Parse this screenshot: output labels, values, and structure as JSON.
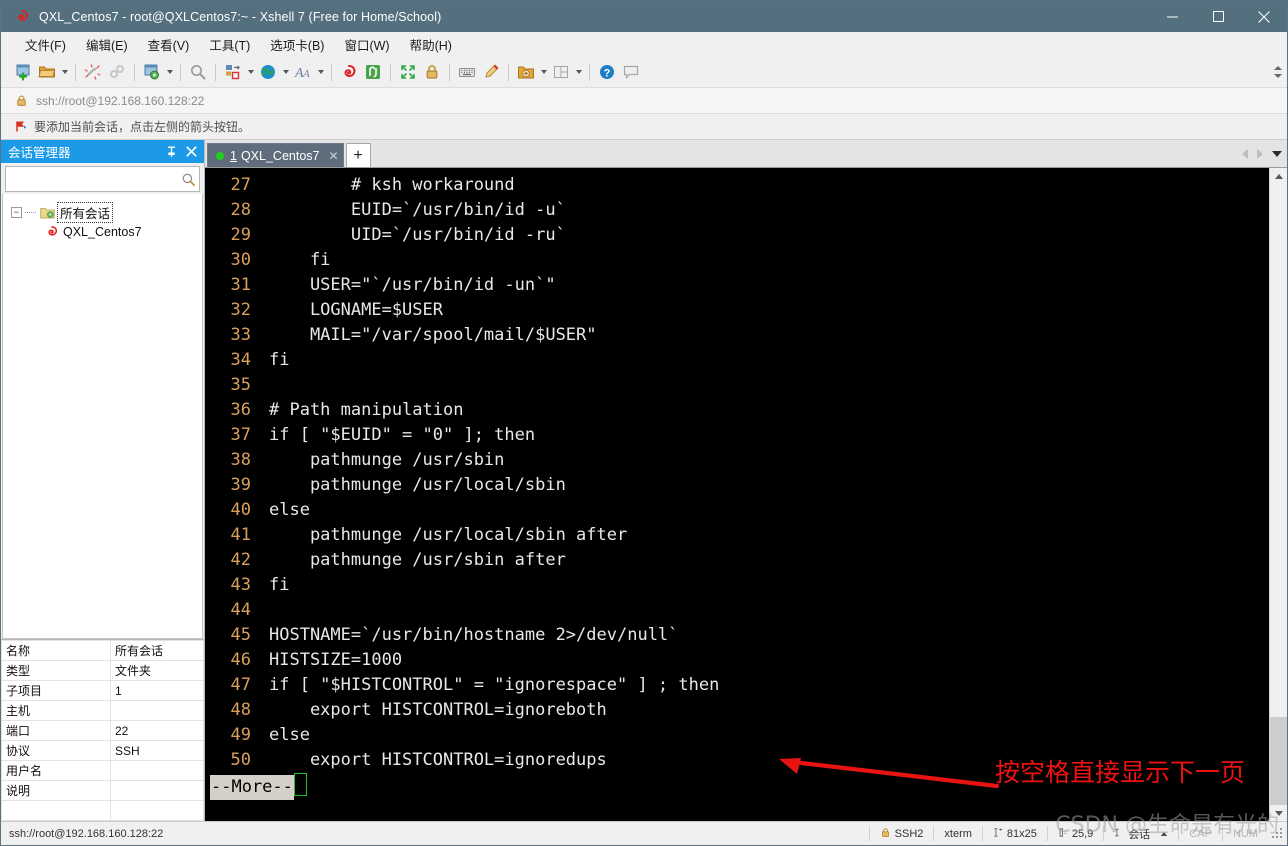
{
  "window": {
    "title": "QXL_Centos7 - root@QXLCentos7:~ - Xshell 7 (Free for Home/School)",
    "app_icon": "xshell-icon",
    "minimize_label": "─",
    "maximize_label": "□",
    "close_label": "✕"
  },
  "menubar": {
    "items": [
      {
        "label": "文件(F)",
        "name": "menu-file"
      },
      {
        "label": "编辑(E)",
        "name": "menu-edit"
      },
      {
        "label": "查看(V)",
        "name": "menu-view"
      },
      {
        "label": "工具(T)",
        "name": "menu-tools"
      },
      {
        "label": "选项卡(B)",
        "name": "menu-tabs"
      },
      {
        "label": "窗口(W)",
        "name": "menu-window"
      },
      {
        "label": "帮助(H)",
        "name": "menu-help"
      }
    ]
  },
  "toolbar": {
    "icons": [
      "new-session-icon",
      "open-folder-icon",
      "connect-icon",
      "disconnect-icon",
      "session-properties-icon",
      "find-icon",
      "transfer-icon",
      "browser-icon",
      "font-icon",
      "xshell-icon",
      "xftp-icon",
      "fullscreen-icon",
      "lock-icon",
      "keyboard-icon",
      "highlight-icon",
      "compose-icon",
      "layout-icon",
      "help-icon",
      "feedback-icon"
    ]
  },
  "addressbar": {
    "lock_icon": "lock-icon",
    "url": "ssh://root@192.168.160.128:22"
  },
  "notice": {
    "flag_icon": "flag-icon",
    "text": "要添加当前会话，点击左侧的箭头按钮。"
  },
  "sidebar": {
    "title": "会话管理器",
    "pin_icon": "pin-icon",
    "close_icon": "close-icon",
    "search": {
      "value": "",
      "placeholder": "",
      "icon": "search-icon"
    },
    "tree": [
      {
        "label": "所有会话",
        "icon": "folder-icon",
        "level": 1,
        "selected": true,
        "expander": "−"
      },
      {
        "label": "QXL_Centos7",
        "icon": "xshell-session-icon",
        "level": 2,
        "selected": false
      }
    ],
    "properties": [
      {
        "key": "名称",
        "value": "所有会话"
      },
      {
        "key": "类型",
        "value": "文件夹"
      },
      {
        "key": "子项目",
        "value": "1"
      },
      {
        "key": "主机",
        "value": ""
      },
      {
        "key": "端口",
        "value": "22"
      },
      {
        "key": "协议",
        "value": "SSH"
      },
      {
        "key": "用户名",
        "value": ""
      },
      {
        "key": "说明",
        "value": ""
      },
      {
        "key": "",
        "value": ""
      }
    ]
  },
  "tabs": {
    "items": [
      {
        "number": "1",
        "label": "QXL_Centos7",
        "status_dot": "#20cf20",
        "close_icon": "close-icon",
        "active": true
      }
    ],
    "new_tab_label": "+",
    "nav_left_icon": "chevron-left-icon",
    "nav_right_icon": "chevron-right-icon",
    "nav_menu_icon": "chevron-down-icon"
  },
  "terminal": {
    "lines": [
      {
        "num": "27",
        "text": "        # ksh workaround"
      },
      {
        "num": "28",
        "text": "        EUID=`/usr/bin/id -u`"
      },
      {
        "num": "29",
        "text": "        UID=`/usr/bin/id -ru`"
      },
      {
        "num": "30",
        "text": "    fi"
      },
      {
        "num": "31",
        "text": "    USER=\"`/usr/bin/id -un`\""
      },
      {
        "num": "32",
        "text": "    LOGNAME=$USER"
      },
      {
        "num": "33",
        "text": "    MAIL=\"/var/spool/mail/$USER\""
      },
      {
        "num": "34",
        "text": "fi"
      },
      {
        "num": "35",
        "text": ""
      },
      {
        "num": "36",
        "text": "# Path manipulation"
      },
      {
        "num": "37",
        "text": "if [ \"$EUID\" = \"0\" ]; then"
      },
      {
        "num": "38",
        "text": "    pathmunge /usr/sbin"
      },
      {
        "num": "39",
        "text": "    pathmunge /usr/local/sbin"
      },
      {
        "num": "40",
        "text": "else"
      },
      {
        "num": "41",
        "text": "    pathmunge /usr/local/sbin after"
      },
      {
        "num": "42",
        "text": "    pathmunge /usr/sbin after"
      },
      {
        "num": "43",
        "text": "fi"
      },
      {
        "num": "44",
        "text": ""
      },
      {
        "num": "45",
        "text": "HOSTNAME=`/usr/bin/hostname 2>/dev/null`"
      },
      {
        "num": "46",
        "text": "HISTSIZE=1000"
      },
      {
        "num": "47",
        "text": "if [ \"$HISTCONTROL\" = \"ignorespace\" ] ; then"
      },
      {
        "num": "48",
        "text": "    export HISTCONTROL=ignoreboth"
      },
      {
        "num": "49",
        "text": "else"
      },
      {
        "num": "50",
        "text": "    export HISTCONTROL=ignoredups"
      }
    ],
    "prompt": "--More--",
    "annotation": {
      "text": "按空格直接显示下一页",
      "color": "#ee1111",
      "arrow_icon": "left-arrow-annotation-icon"
    },
    "colors": {
      "background": "#000000",
      "foreground": "#e8e8e8",
      "line_number": "#d9a05b",
      "cursor": "#27c427"
    }
  },
  "statusbar": {
    "connection": "ssh://root@192.168.160.128:22",
    "cells": [
      {
        "icon": "lock-icon",
        "label": "SSH2",
        "name": "status-protocol"
      },
      {
        "icon": "",
        "label": "xterm",
        "name": "status-terminal-type"
      },
      {
        "icon": "size-icon",
        "label": "81x25",
        "name": "status-size"
      },
      {
        "icon": "caret-icon",
        "label": "25,9",
        "name": "status-cursor-position"
      },
      {
        "icon": "session-icon",
        "label": "会话",
        "name": "status-session"
      },
      {
        "icon": "",
        "label": "CAP",
        "name": "status-caps"
      },
      {
        "icon": "",
        "label": "NUM",
        "name": "status-num"
      }
    ]
  },
  "watermark": {
    "text": "CSDN @生命是有光的"
  }
}
